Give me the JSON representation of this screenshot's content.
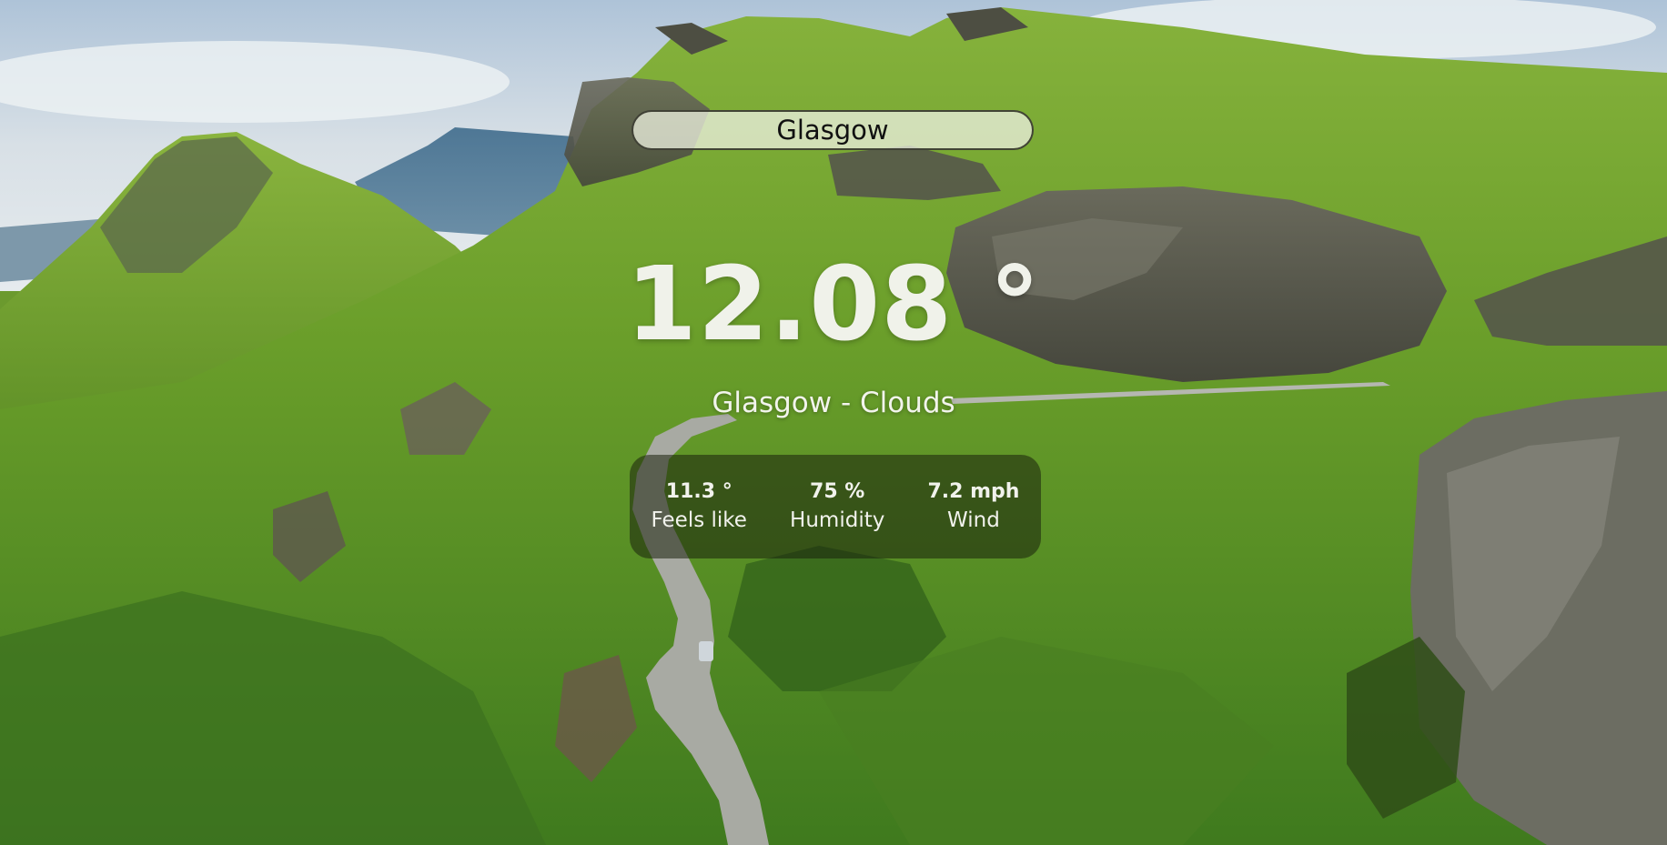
{
  "search": {
    "value": "Glasgow",
    "placeholder": ""
  },
  "weather": {
    "temperature": "12.08 °",
    "location_description": "Glasgow - Clouds"
  },
  "stats": [
    {
      "value": "11.3 °",
      "label": "Feels like"
    },
    {
      "value": "75 %",
      "label": "Humidity"
    },
    {
      "value": "7.2 mph",
      "label": "Wind"
    }
  ],
  "colors": {
    "sky": "#c9d6e2",
    "grass": "#6fa132",
    "rock": "#5a5a4e",
    "road": "#a9aaa3",
    "text": "#f1f2ec",
    "stats_panel": "#19200c"
  }
}
